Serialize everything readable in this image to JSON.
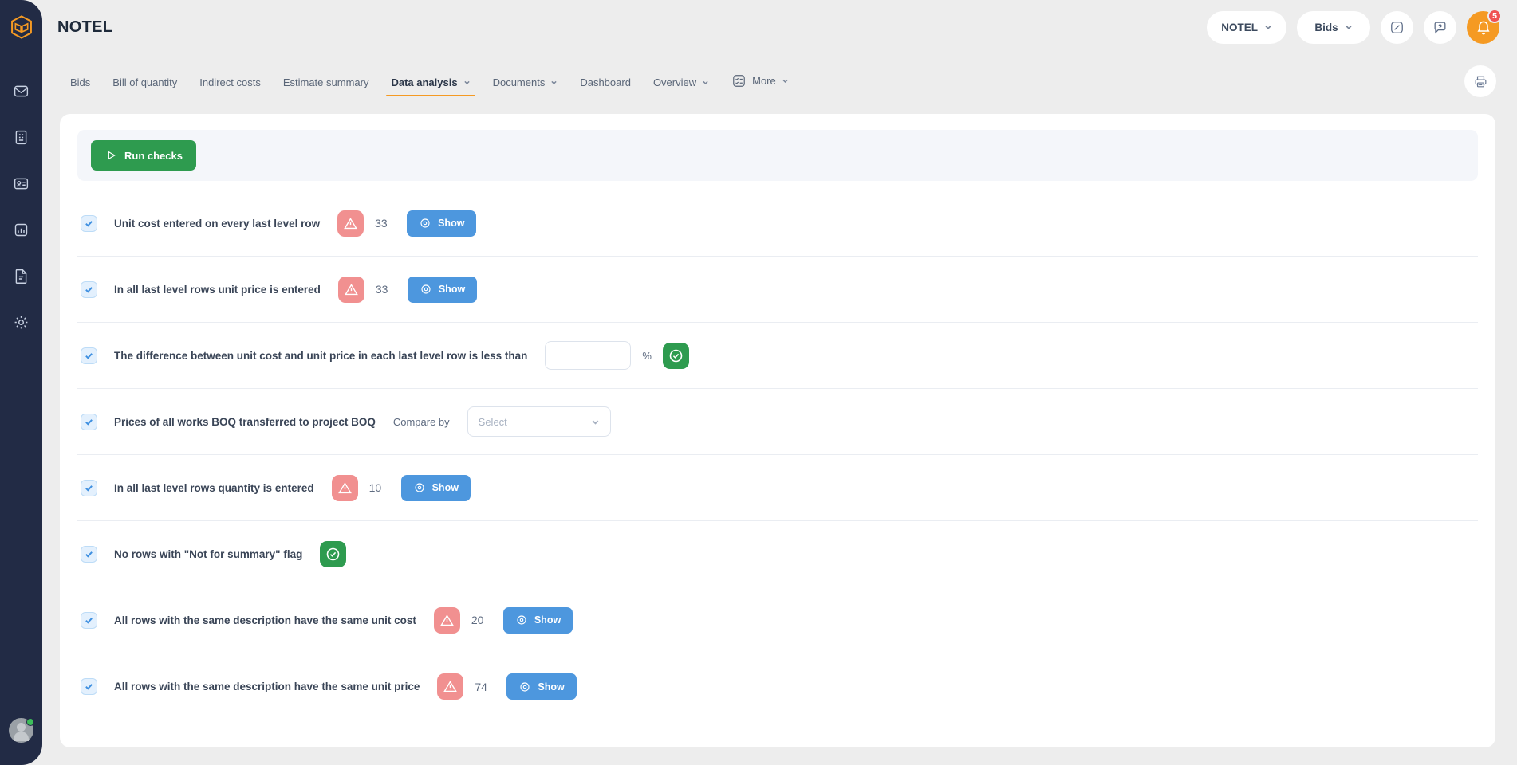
{
  "app": {
    "title": "NOTEL",
    "logo_icon": "cube-logo-icon",
    "accent_color": "#F59A23",
    "sidebar_bg": "#222B45"
  },
  "sidebar": {
    "items": [
      {
        "icon": "mail-icon"
      },
      {
        "icon": "building-icon"
      },
      {
        "icon": "contact-card-icon"
      },
      {
        "icon": "analytics-chart-icon"
      },
      {
        "icon": "document-icon"
      },
      {
        "icon": "gear-icon"
      }
    ],
    "avatar": {
      "icon": "avatar-icon",
      "status": "online",
      "status_color": "#3DBE5A"
    }
  },
  "header": {
    "org_selector": {
      "label": "NOTEL",
      "icon": "chevron-down-icon"
    },
    "section_selector": {
      "label": "Bids",
      "icon": "chevron-down-icon"
    },
    "expand_button": {
      "icon": "expand-arrows-icon"
    },
    "help_button": {
      "icon": "help-chat-icon"
    },
    "notifications": {
      "icon": "bell-icon",
      "count": "5",
      "badge_color": "#F05252",
      "button_color": "#F59A23"
    }
  },
  "tabs": [
    {
      "label": "Bids",
      "has_dropdown": false,
      "active": false
    },
    {
      "label": "Bill of quantity",
      "has_dropdown": false,
      "active": false
    },
    {
      "label": "Indirect costs",
      "has_dropdown": false,
      "active": false
    },
    {
      "label": "Estimate summary",
      "has_dropdown": false,
      "active": false
    },
    {
      "label": "Data analysis",
      "has_dropdown": true,
      "active": true
    },
    {
      "label": "Documents",
      "has_dropdown": true,
      "active": false
    },
    {
      "label": "Dashboard",
      "has_dropdown": false,
      "active": false
    },
    {
      "label": "Overview",
      "has_dropdown": true,
      "active": false
    },
    {
      "label": "More",
      "has_dropdown": true,
      "active": false,
      "icon": "checklist-icon"
    }
  ],
  "print_button": {
    "icon": "printer-icon"
  },
  "toolbar": {
    "run_checks_label": "Run checks",
    "run_checks_icon": "play-icon",
    "run_checks_color": "#2E9B4F"
  },
  "checks": [
    {
      "id": "unit-cost-every-last-level-row",
      "label": "Unit cost entered on every last level row",
      "checked": true,
      "status": "warning",
      "status_icon": "warning-triangle-icon",
      "count": "33",
      "action": {
        "label": "Show",
        "icon": "eye-target-icon"
      }
    },
    {
      "id": "unit-price-entered",
      "label": "In all last level rows unit price is entered",
      "checked": true,
      "status": "warning",
      "status_icon": "warning-triangle-icon",
      "count": "33",
      "action": {
        "label": "Show",
        "icon": "eye-target-icon"
      }
    },
    {
      "id": "difference-unit-cost-price",
      "label": "The difference between unit cost and unit price in each last level row is less than",
      "checked": true,
      "status": "ok",
      "status_icon": "check-circle-icon",
      "input": {
        "value": "",
        "placeholder": "",
        "suffix": "%"
      }
    },
    {
      "id": "prices-boq-transferred",
      "label": "Prices of all works BOQ transferred to project BOQ",
      "checked": true,
      "status": "none",
      "compare": {
        "label": "Compare by",
        "selected": "Select",
        "icon": "chevron-down-icon"
      }
    },
    {
      "id": "quantity-entered",
      "label": "In all last level rows quantity is entered",
      "checked": true,
      "status": "warning",
      "status_icon": "warning-triangle-icon",
      "count": "10",
      "action": {
        "label": "Show",
        "icon": "eye-target-icon"
      }
    },
    {
      "id": "no-not-for-summary-flag",
      "label": "No rows with \"Not for summary\" flag",
      "checked": true,
      "status": "ok",
      "status_icon": "check-circle-icon"
    },
    {
      "id": "same-description-same-unit-cost",
      "label": "All rows with the same description have the same unit cost",
      "checked": true,
      "status": "warning",
      "status_icon": "warning-triangle-icon",
      "count": "20",
      "action": {
        "label": "Show",
        "icon": "eye-target-icon"
      }
    },
    {
      "id": "same-description-same-unit-price",
      "label": "All rows with the same description have the same unit price",
      "checked": true,
      "status": "warning",
      "status_icon": "warning-triangle-icon",
      "count": "74",
      "action": {
        "label": "Show",
        "icon": "eye-target-icon"
      }
    }
  ],
  "colors": {
    "warning_badge": "#F19090",
    "ok_badge": "#2E9B4F",
    "show_button": "#4D97DE",
    "checkbox": "#E3F0FD",
    "page_bg": "#EDEDED",
    "toolbar_bg": "#F4F6FA"
  }
}
